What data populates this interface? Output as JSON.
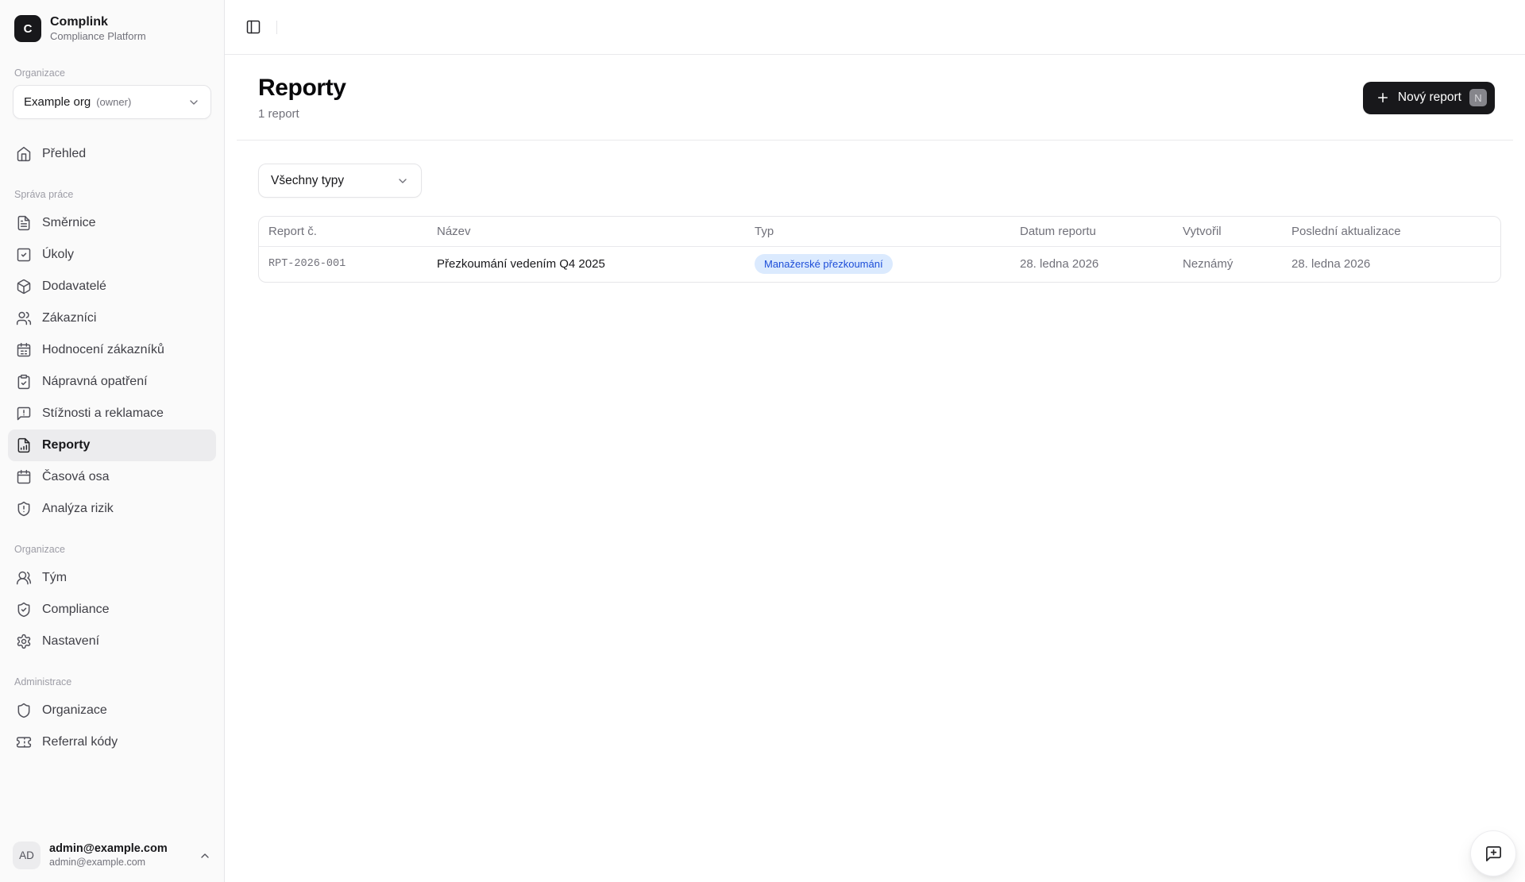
{
  "brand": {
    "logo_letter": "C",
    "name": "Complink",
    "tagline": "Compliance Platform"
  },
  "org_switcher": {
    "section_label": "Organizace",
    "org_name": "Example org",
    "role": "(owner)"
  },
  "sidebar": {
    "groups": [
      {
        "label": "",
        "items": [
          {
            "label": "Přehled",
            "icon": "house-icon"
          }
        ]
      },
      {
        "label": "Správa práce",
        "items": [
          {
            "label": "Směrnice",
            "icon": "file-text-icon"
          },
          {
            "label": "Úkoly",
            "icon": "square-check-icon"
          },
          {
            "label": "Dodavatelé",
            "icon": "package-icon"
          },
          {
            "label": "Zákazníci",
            "icon": "users-icon"
          },
          {
            "label": "Hodnocení zákazníků",
            "icon": "calendar-days-icon"
          },
          {
            "label": "Nápravná opatření",
            "icon": "clipboard-check-icon"
          },
          {
            "label": "Stížnosti a reklamace",
            "icon": "message-square-warning-icon"
          },
          {
            "label": "Reporty",
            "icon": "file-chart-icon",
            "active": true
          },
          {
            "label": "Časová osa",
            "icon": "calendar-icon"
          },
          {
            "label": "Analýza rizik",
            "icon": "shield-alert-icon"
          }
        ]
      },
      {
        "label": "Organizace",
        "items": [
          {
            "label": "Tým",
            "icon": "users-round-icon"
          },
          {
            "label": "Compliance",
            "icon": "shield-check-icon"
          },
          {
            "label": "Nastavení",
            "icon": "settings-icon"
          }
        ]
      },
      {
        "label": "Administrace",
        "items": [
          {
            "label": "Organizace",
            "icon": "shield-icon"
          },
          {
            "label": "Referral kódy",
            "icon": "ticket-icon"
          }
        ]
      }
    ]
  },
  "user": {
    "initials": "AD",
    "name": "admin@example.com",
    "email": "admin@example.com"
  },
  "page": {
    "title": "Reporty",
    "subtitle": "1 report"
  },
  "actions": {
    "new_report_label": "Nový report",
    "new_report_shortcut": "N"
  },
  "filters": {
    "type_filter_value": "Všechny typy"
  },
  "table": {
    "columns": [
      "Report č.",
      "Název",
      "Typ",
      "Datum reportu",
      "Vytvořil",
      "Poslední aktualizace"
    ],
    "rows": [
      {
        "number": "RPT-2026-001",
        "name": "Přezkoumání vedením Q4 2025",
        "type": "Manažerské přezkoumání",
        "report_date": "28. ledna 2026",
        "created_by": "Neznámý",
        "last_updated": "28. ledna 2026"
      }
    ]
  },
  "colors": {
    "sidebar_bg": "#fafafa",
    "accent_dark": "#18181b",
    "badge_bg": "#dbeafe",
    "badge_text": "#1d4ed8",
    "muted_text": "#71717a",
    "border": "#e4e4e7"
  }
}
